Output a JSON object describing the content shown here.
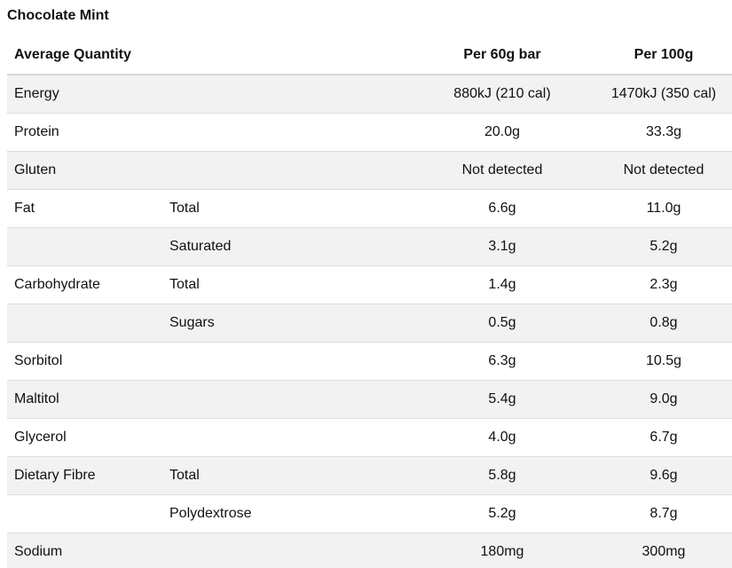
{
  "title": "Chocolate Mint",
  "header": {
    "average_quantity": "Average Quantity",
    "per_bar": "Per 60g bar",
    "per_100g": "Per 100g"
  },
  "rows": [
    {
      "name": "Energy",
      "sub": "",
      "per_bar": "880kJ (210 cal)",
      "per_100g": "1470kJ (350 cal)"
    },
    {
      "name": "Protein",
      "sub": "",
      "per_bar": "20.0g",
      "per_100g": "33.3g"
    },
    {
      "name": "Gluten",
      "sub": "",
      "per_bar": "Not detected",
      "per_100g": "Not detected"
    },
    {
      "name": "Fat",
      "sub": "Total",
      "per_bar": "6.6g",
      "per_100g": "11.0g"
    },
    {
      "name": "",
      "sub": "Saturated",
      "per_bar": "3.1g",
      "per_100g": "5.2g"
    },
    {
      "name": "Carbohydrate",
      "sub": "Total",
      "per_bar": "1.4g",
      "per_100g": "2.3g"
    },
    {
      "name": "",
      "sub": "Sugars",
      "per_bar": "0.5g",
      "per_100g": "0.8g"
    },
    {
      "name": "Sorbitol",
      "sub": "",
      "per_bar": "6.3g",
      "per_100g": "10.5g"
    },
    {
      "name": "Maltitol",
      "sub": "",
      "per_bar": "5.4g",
      "per_100g": "9.0g"
    },
    {
      "name": "Glycerol",
      "sub": "",
      "per_bar": "4.0g",
      "per_100g": "6.7g"
    },
    {
      "name": "Dietary Fibre",
      "sub": "Total",
      "per_bar": "5.8g",
      "per_100g": "9.6g"
    },
    {
      "name": "",
      "sub": "Polydextrose",
      "per_bar": "5.2g",
      "per_100g": "8.7g"
    },
    {
      "name": "Sodium",
      "sub": "",
      "per_bar": "180mg",
      "per_100g": "300mg"
    }
  ]
}
